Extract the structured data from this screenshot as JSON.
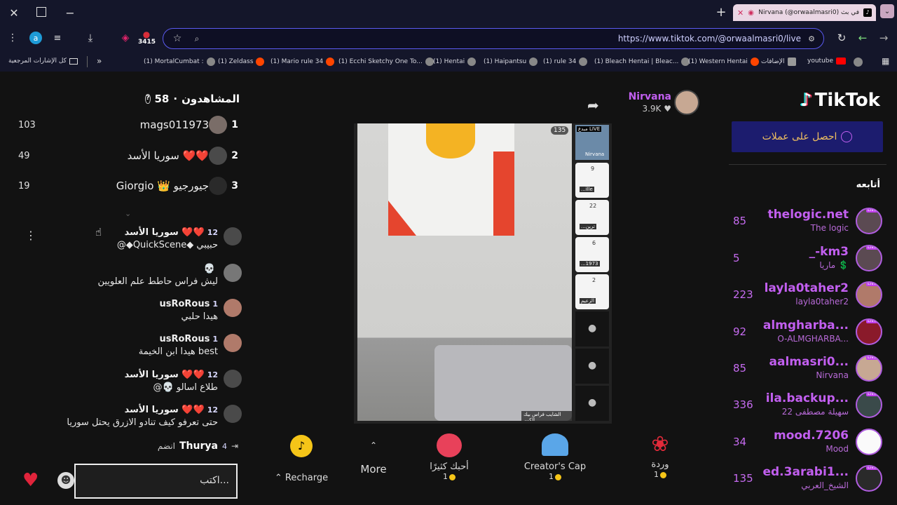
{
  "browser": {
    "tab_title": "Nirvana (@orwaalmasri0) في بث",
    "url": "https://www.tiktok.com/@orwaalmasri0/live",
    "badge_count": "3415",
    "profile_letter": "a"
  },
  "bookmarks": {
    "all_label": "كل الإشارات المرجعية",
    "items": [
      "(1) MortalCumbat :",
      "(1) Zeldass",
      "(1) Mario rule 34",
      "(1) Ecchi Sketchy One To...",
      "(1) Hentai",
      "(1) Haipantsu",
      "(1) rule 34",
      "(1) Bleach Hentai | Bleac...",
      "(1) Western Hentai",
      "الإضافات",
      "youtube"
    ]
  },
  "viewers": {
    "label": "المشاهدون",
    "count": "58"
  },
  "leaderboard": [
    {
      "rank": "1",
      "name": "mags011973",
      "score": "103"
    },
    {
      "rank": "2",
      "name": "سوريا الأسد ❤️❤️",
      "score": "49"
    },
    {
      "rank": "3",
      "name": "Giorgio 👑 جيورجيو",
      "score": "19"
    }
  ],
  "comments": [
    {
      "user": "سوريا الأسد ❤️❤️",
      "level": "12",
      "text": "@◆QuickScene◆ حبيبي"
    },
    {
      "user": "",
      "level": "",
      "text": "ليش فراس حاطط علم العلويين"
    },
    {
      "user": "usRoRous",
      "level": "1",
      "text": "هيدا حلبي"
    },
    {
      "user": "usRoRous",
      "level": "1",
      "text": "هيدا ابن الخيمة best"
    },
    {
      "user": "سوريا الأسد ❤️❤️",
      "level": "12",
      "text": "@💀 طلاع اسالو"
    },
    {
      "user": "سوريا الأسد ❤️❤️",
      "level": "12",
      "text": "حتى تعرفو كيف تنادو الازرق يحتل سوريا"
    }
  ],
  "join": {
    "user": "Thurya",
    "level": "4",
    "text": "انضم"
  },
  "comment_input": {
    "placeholder": "اكتب..."
  },
  "host": {
    "name": "Nirvana",
    "likes": "3.9K"
  },
  "video": {
    "viewer_badge": "135",
    "caption": "الشايب فراس بيك الكبير",
    "live_tile_label": "مبدع LIVE",
    "live_tile_name": "Nirvana",
    "side_tiles": [
      {
        "num": "9",
        "label": "...ille"
      },
      {
        "num": "22",
        "label": "...ترين"
      },
      {
        "num": "6",
        "label": "...1973"
      },
      {
        "num": "2",
        "label": "الزعيم"
      }
    ]
  },
  "gifts": [
    {
      "name": "وردة",
      "price": "1"
    },
    {
      "name": "Creator's Cap",
      "price": "1"
    },
    {
      "name": "أحبك كثيرًا",
      "price": "1"
    }
  ],
  "more_label": "More",
  "recharge_label": "Recharge",
  "logo_text": "TikTok",
  "get_coins": "احصل على عملات",
  "following_title": "أتابعه",
  "following": [
    {
      "name": "thelogic.net",
      "sub": "The logic",
      "count": "85"
    },
    {
      "name": "_-km3",
      "sub": "ماريا 💲",
      "count": "5"
    },
    {
      "name": "layla0taher2",
      "sub": "layla0taher2",
      "count": "223"
    },
    {
      "name": "almgharba...",
      "sub": "O-ALMGHARBA...",
      "count": "92"
    },
    {
      "name": "aalmasri0...",
      "sub": "Nirvana",
      "count": "85"
    },
    {
      "name": "ila.backup...",
      "sub": "سهيلة مصطفى 22",
      "count": "336"
    },
    {
      "name": "mood.7206",
      "sub": "Mood",
      "count": "34"
    },
    {
      "name": "ed.3arabi1...",
      "sub": "الشيخ_العربي",
      "count": "135"
    }
  ],
  "colors": {
    "accent": "#c25ff0",
    "url_border": "#5a5af0",
    "heart": "#e0243b"
  }
}
